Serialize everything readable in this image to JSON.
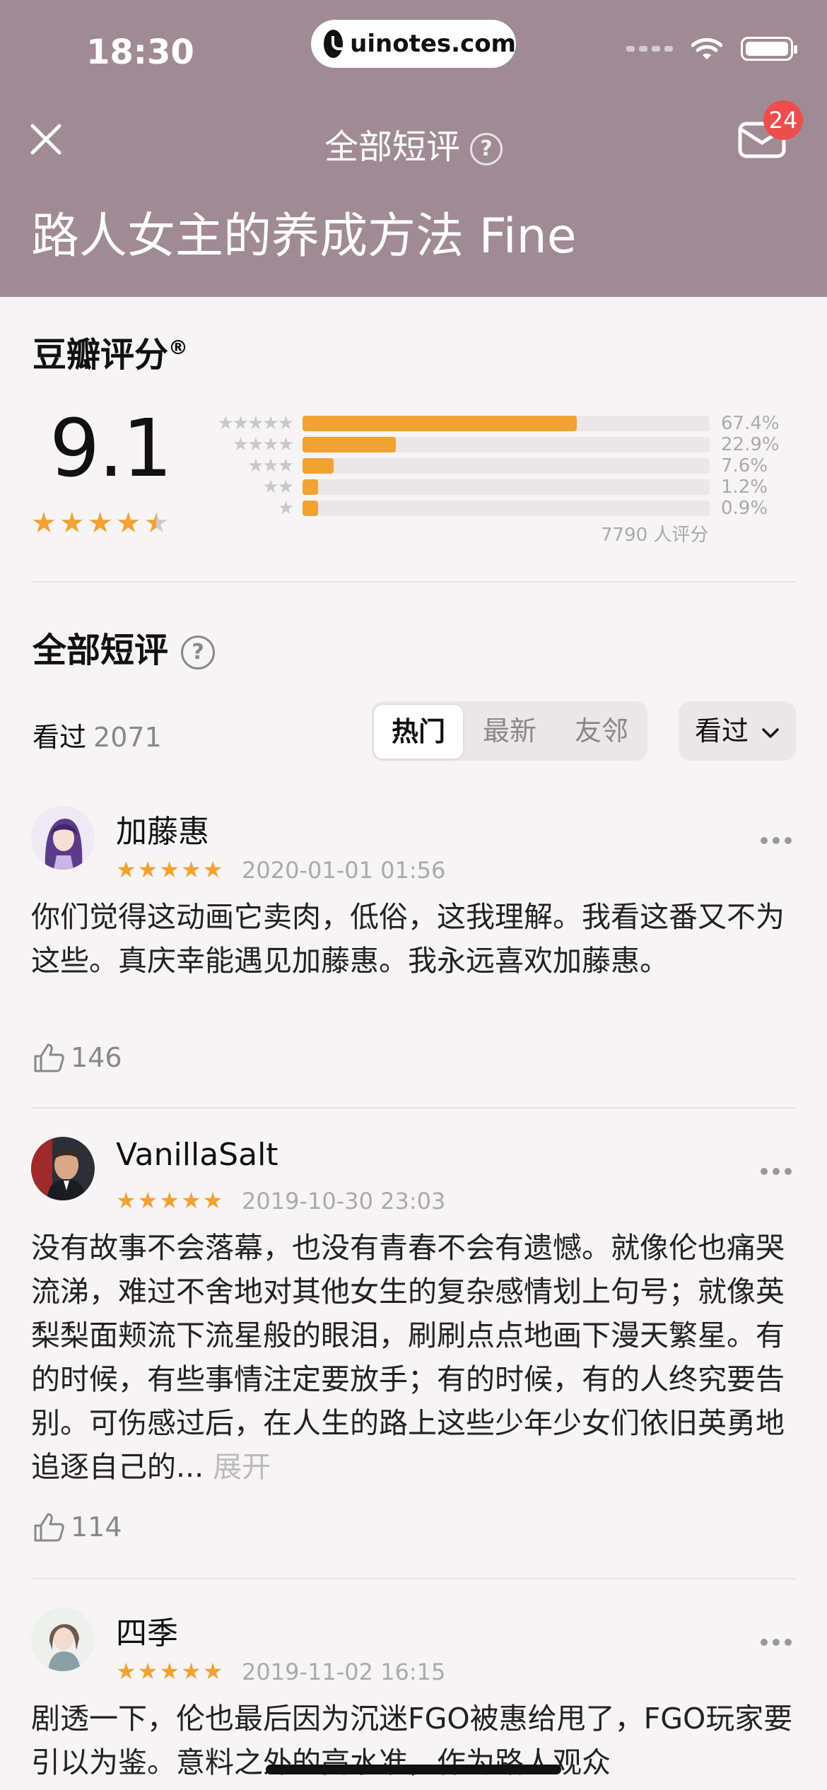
{
  "status_bar": {
    "time": "18:30",
    "url": "uinotes.com"
  },
  "nav": {
    "title": "全部短评",
    "badge": "24"
  },
  "movie": {
    "title": "路人女主的养成方法 Fine"
  },
  "rating": {
    "section_title": "豆瓣评分",
    "registered_mark": "®",
    "score": "9.1",
    "stars_value": 4.5,
    "distribution": [
      {
        "stars": "★★★★★",
        "percent_label": "67.4%",
        "percent": 67.4
      },
      {
        "stars": "★★★★",
        "percent_label": "22.9%",
        "percent": 22.9
      },
      {
        "stars": "★★★",
        "percent_label": "7.6%",
        "percent": 7.6
      },
      {
        "stars": "★★",
        "percent_label": "1.2%",
        "percent": 1.2
      },
      {
        "stars": "★",
        "percent_label": "0.9%",
        "percent": 0.9
      }
    ],
    "count_label": "7790 人评分"
  },
  "reviews_section": {
    "title": "全部短评",
    "watched_label": "看过",
    "watched_count": "2071",
    "tabs": [
      {
        "label": "热门",
        "active": true
      },
      {
        "label": "最新",
        "active": false
      },
      {
        "label": "友邻",
        "active": false
      }
    ],
    "filter_label": "看过"
  },
  "reviews": [
    {
      "name": "加藤惠",
      "time": "2020-01-01 01:56",
      "text": "你们觉得这动画它卖肉，低俗，这我理解。我看这番又不为这些。真庆幸能遇见加藤惠。我永远喜欢加藤惠。",
      "likes": "146",
      "expand": ""
    },
    {
      "name": "VanillaSalt",
      "time": "2019-10-30 23:03",
      "text": "没有故事不会落幕，也没有青春不会有遗憾。就像伦也痛哭流涕，难过不舍地对其他女生的复杂感情划上句号；就像英梨梨面颊流下流星般的眼泪，刷刷点点地画下漫天繁星。有的时候，有些事情注定要放手；有的时候，有的人终究要告别。可伤感过后，在人生的路上这些少年少女们依旧英勇地追逐自己的...",
      "likes": "114",
      "expand": "展开"
    },
    {
      "name": "四季",
      "time": "2019-11-02 16:15",
      "text": "剧透一下，伦也最后因为沉迷FGO被惠给甩了，FGO玩家要引以为鉴。意料之外的高水准，作为路人观众",
      "likes": "",
      "expand": ""
    }
  ],
  "colors": {
    "header_bg": "#a08b94",
    "star": "#f0a233",
    "badge": "#ee4d4d"
  }
}
